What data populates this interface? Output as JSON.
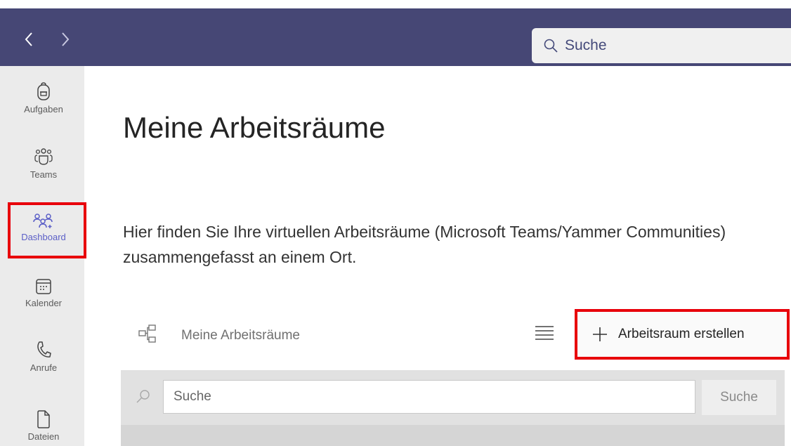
{
  "topbar": {
    "back_icon": "chevron-left-icon",
    "forward_icon": "chevron-right-icon",
    "search_placeholder": "Suche",
    "background_color": "#464775"
  },
  "sidebar": {
    "items": [
      {
        "label": "Aufgaben",
        "icon": "backpack-icon"
      },
      {
        "label": "Teams",
        "icon": "teams-icon"
      },
      {
        "label": "Dashboard",
        "icon": "dashboard-people-icon",
        "active": true
      },
      {
        "label": "Kalender",
        "icon": "calendar-icon"
      },
      {
        "label": "Anrufe",
        "icon": "phone-icon"
      },
      {
        "label": "Dateien",
        "icon": "file-icon"
      }
    ]
  },
  "main": {
    "title": "Meine Arbeitsräume",
    "description": "Hier finden Sie Ihre virtuellen Arbeitsräume (Microsoft Teams/Yammer Communities) zusammengefasst an einem Ort.",
    "workspace_header": {
      "title": "Meine Arbeitsräume",
      "create_button": "Arbeitsraum erstellen"
    },
    "search": {
      "placeholder": "Suche",
      "button": "Suche"
    }
  },
  "colors": {
    "highlight": "#e8000b",
    "accent": "#5b5fc7"
  }
}
